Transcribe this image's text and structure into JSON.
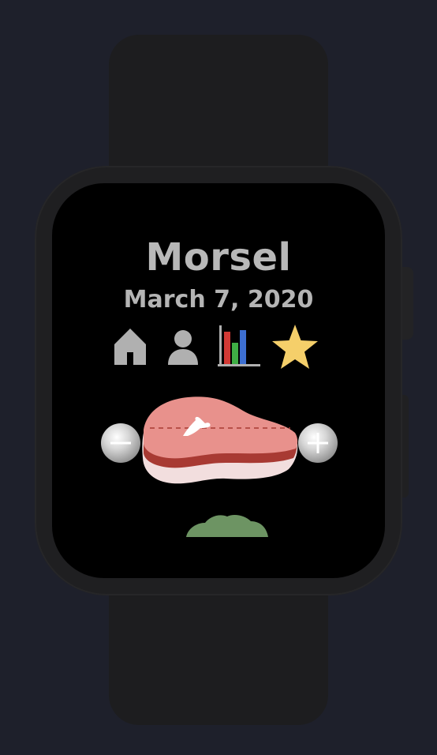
{
  "app": {
    "title": "Morsel",
    "date": "March 7, 2020"
  },
  "nav": [
    {
      "id": "home",
      "icon": "home-icon"
    },
    {
      "id": "profile",
      "icon": "person-icon"
    },
    {
      "id": "stats",
      "icon": "bar-chart-icon"
    },
    {
      "id": "favorites",
      "icon": "star-icon"
    }
  ],
  "controls": {
    "decrease_icon": "minus-icon",
    "increase_icon": "plus-icon"
  },
  "food": {
    "current": "steak-icon",
    "next": "broccoli-icon"
  },
  "colors": {
    "background": "#1e202b",
    "watch_body": "#1d1d1f",
    "screen": "#000000",
    "text": "#b8b8b8",
    "icon_gray": "#b0b0b0",
    "star": "#f5cf6a",
    "bar_red": "#d23a35",
    "bar_green": "#3fae45",
    "bar_blue": "#3d6fd1",
    "steak_meat": "#e8918c",
    "steak_fat": "#f2dede",
    "steak_sear": "#a83a33",
    "broccoli": "#6d9463"
  }
}
